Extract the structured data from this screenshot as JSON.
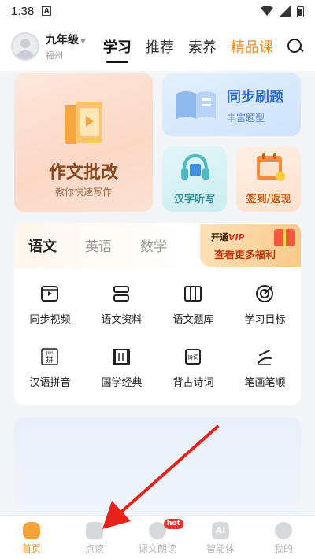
{
  "status_bar": {
    "time": "1:38",
    "indicator": "A"
  },
  "header": {
    "grade": "九年级",
    "city": "福州",
    "tabs": [
      {
        "label": "学习",
        "active": true
      },
      {
        "label": "推荐",
        "active": false
      },
      {
        "label": "素养",
        "active": false
      },
      {
        "label": "精品课",
        "active": false
      }
    ]
  },
  "cards": {
    "essay": {
      "title": "作文批改",
      "subtitle": "教你快速写作"
    },
    "sync": {
      "title": "同步刷题",
      "subtitle": "丰富题型"
    },
    "dictation": {
      "title": "汉字听写"
    },
    "signin": {
      "title": "签到/返现"
    }
  },
  "subjects": {
    "tabs": [
      {
        "label": "语文",
        "active": true
      },
      {
        "label": "英语",
        "active": false
      },
      {
        "label": "数学",
        "active": false
      }
    ],
    "vip": {
      "line1_prefix": "开通",
      "line1_vip": "VIP",
      "line2": "查看更多福利"
    }
  },
  "grid_items": [
    {
      "label": "同步视频",
      "icon": "video-icon"
    },
    {
      "label": "语文资料",
      "icon": "stack-icon"
    },
    {
      "label": "语文题库",
      "icon": "books-icon"
    },
    {
      "label": "学习目标",
      "icon": "target-icon"
    },
    {
      "label": "汉语拼音",
      "icon": "pinyin-icon",
      "glyph_top": "pin",
      "glyph_bottom": "拼"
    },
    {
      "label": "国学经典",
      "icon": "scroll-icon"
    },
    {
      "label": "背古诗词",
      "icon": "poem-book-icon",
      "glyph": "诗词"
    },
    {
      "label": "笔画笔顺",
      "icon": "stroke-icon"
    }
  ],
  "bottom_nav": [
    {
      "label": "首页",
      "active": true
    },
    {
      "label": "点读",
      "active": false
    },
    {
      "label": "课文朗读",
      "active": false,
      "badge": "hot"
    },
    {
      "label": "智能体",
      "active": false,
      "icon_text": "Ai"
    },
    {
      "label": "我的",
      "active": false
    }
  ],
  "colors": {
    "accent": "#f08a1c",
    "brand_blue": "#2d6bd1",
    "annotation_arrow": "#e8221b"
  }
}
